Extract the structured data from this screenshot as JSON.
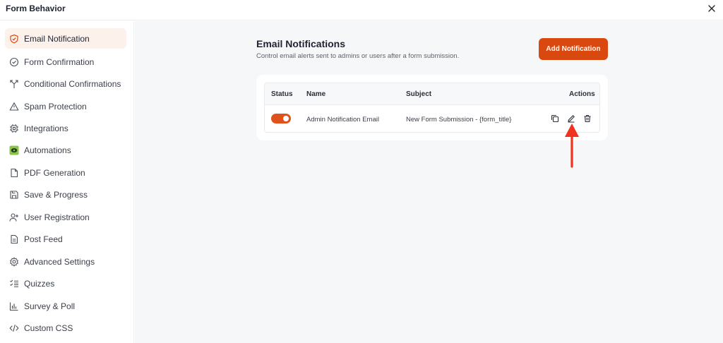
{
  "window": {
    "title": "Form Behavior",
    "close_icon": "close-icon"
  },
  "sidebar": {
    "items": [
      {
        "label": "Email Notification",
        "icon": "shield-icon",
        "active": true
      },
      {
        "label": "Form Confirmation",
        "icon": "check-circle-icon"
      },
      {
        "label": "Conditional Confirmations",
        "icon": "split-arrows-icon"
      },
      {
        "label": "Spam Protection",
        "icon": "warning-triangle-icon"
      },
      {
        "label": "Integrations",
        "icon": "chip-icon"
      },
      {
        "label": "Automations",
        "icon": "automation-logo-icon"
      },
      {
        "label": "PDF Generation",
        "icon": "file-icon"
      },
      {
        "label": "Save & Progress",
        "icon": "floppy-disk-icon"
      },
      {
        "label": "User Registration",
        "icon": "user-plus-icon"
      },
      {
        "label": "Post Feed",
        "icon": "document-icon"
      },
      {
        "label": "Advanced Settings",
        "icon": "gear-icon"
      },
      {
        "label": "Quizzes",
        "icon": "checklist-icon"
      },
      {
        "label": "Survey & Poll",
        "icon": "bar-chart-icon"
      },
      {
        "label": "Custom CSS",
        "icon": "code-icon"
      }
    ]
  },
  "main": {
    "title": "Email Notifications",
    "subtitle": "Control email alerts sent to admins or users after a form submission.",
    "add_button": "Add Notification",
    "table": {
      "headers": {
        "status": "Status",
        "name": "Name",
        "subject": "Subject",
        "actions": "Actions"
      },
      "rows": [
        {
          "status_on": true,
          "name": "Admin Notification Email",
          "subject": "New Form Submission - {form_title}"
        }
      ]
    }
  },
  "colors": {
    "accent": "#d9480f",
    "toggle_on": "#e0521c",
    "active_bg": "#fdf1ec",
    "annotation_arrow": "#f0321e"
  }
}
